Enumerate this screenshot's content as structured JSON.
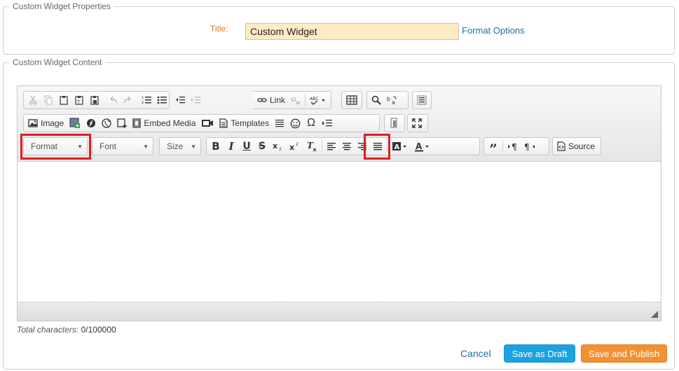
{
  "properties": {
    "legend": "Custom Widget Properties",
    "title_label": "Title:",
    "title_value": "Custom Widget",
    "format_options_link": "Format Options"
  },
  "content": {
    "legend": "Custom Widget Content",
    "toolbar": {
      "link_label": "Link",
      "image_label": "Image",
      "embed_media_label": "Embed Media",
      "templates_label": "Templates",
      "format_combo": "Format",
      "font_combo": "Font",
      "size_combo": "Size",
      "source_label": "Source"
    },
    "total_characters_label": "Total characters:",
    "total_characters_value": "0/100000"
  },
  "actions": {
    "cancel": "Cancel",
    "save_draft": "Save as Draft",
    "save_publish": "Save and Publish"
  },
  "colors": {
    "title_label": "#e07a16",
    "link": "#1e6fa8",
    "draft_button": "#1aa3e0",
    "publish_button": "#f39032",
    "highlight": "#e01d24"
  }
}
